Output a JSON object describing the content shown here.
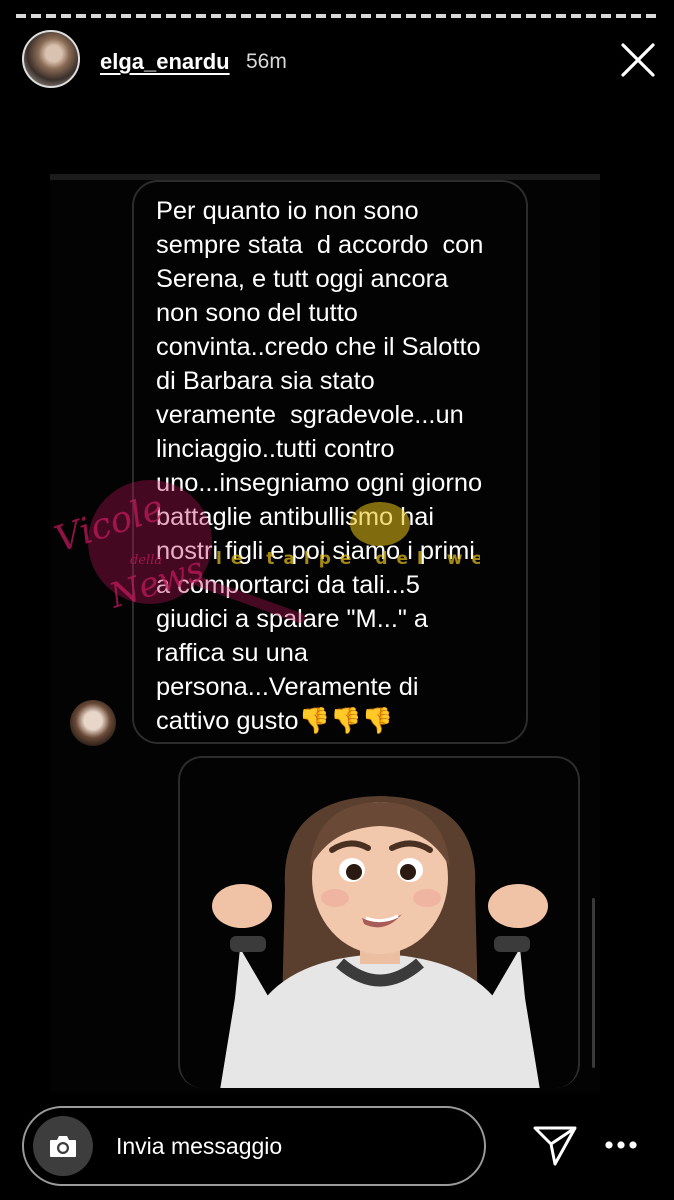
{
  "story": {
    "username": "elga_enardu",
    "time_ago": "56m"
  },
  "message": {
    "text": "Per quanto io non sono\nsempre stata  d accordo  con\nSerena, e tutt oggi ancora\nnon sono del tutto\nconvinta..credo che il Salotto\ndi Barbara sia stato\nveramente  sgradevole...un\nlinciaggio..tutti contro\nuno...insegniamo ogni giorno\nbattaglie antibullismo hai\nnostri figli e poi siamo i primi\na comportarci da tali...5\ngiudici a spalare \"M...\" a\nraffica su una\npersona...Veramente di\ncattivo gusto👎👎👎"
  },
  "watermark": {
    "script_line1": "Vicole",
    "script_small": "della",
    "script_line2": "News",
    "banner": "le talpe del web"
  },
  "composer": {
    "placeholder": "Invia messaggio"
  },
  "icons": {
    "close": "close-icon",
    "camera": "camera-icon",
    "send": "paper-plane-icon",
    "more": "more-dots-icon"
  },
  "colors": {
    "background": "#000000",
    "watermark_pink": "#c0185b",
    "watermark_yellow": "#e8c21a"
  }
}
